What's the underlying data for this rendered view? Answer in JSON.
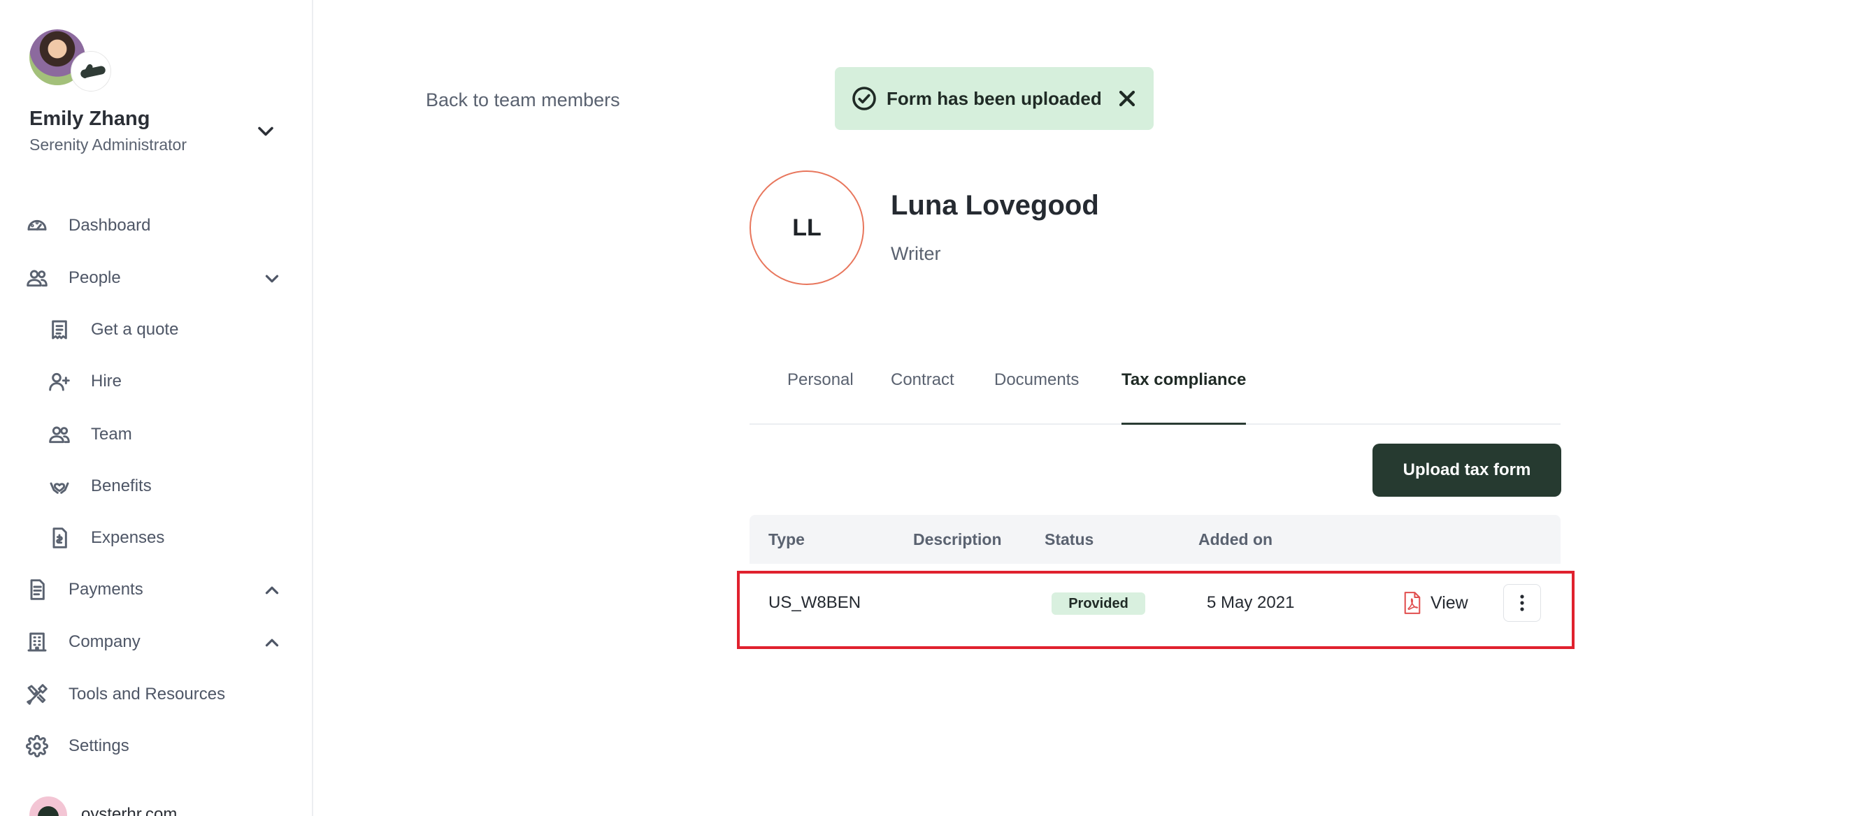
{
  "user": {
    "name": "Emily Zhang",
    "role": "Serenity Administrator"
  },
  "nav": {
    "dashboard": "Dashboard",
    "people": "People",
    "get_quote": "Get a quote",
    "hire": "Hire",
    "team": "Team",
    "benefits": "Benefits",
    "expenses": "Expenses",
    "payments": "Payments",
    "company": "Company",
    "tools": "Tools and Resources",
    "settings": "Settings"
  },
  "footer": {
    "domain": "oysterhr.com"
  },
  "back_link": "Back to team members",
  "toast": {
    "message": "Form has been uploaded"
  },
  "profile": {
    "initials": "LL",
    "name": "Luna Lovegood",
    "role": "Writer"
  },
  "tabs": [
    "Personal",
    "Contract",
    "Documents",
    "Tax compliance"
  ],
  "upload_button": "Upload tax form",
  "table": {
    "headers": [
      "Type",
      "Description",
      "Status",
      "Added on"
    ],
    "rows": [
      {
        "type": "US_W8BEN",
        "description": "",
        "status": "Provided",
        "added_on": "5 May 2021",
        "action": "View"
      }
    ]
  },
  "colors": {
    "primary_dark": "#263a30",
    "toast_bg": "#d6efdc",
    "highlight_border": "#e0212e",
    "avatar_ring": "#e8765c"
  }
}
